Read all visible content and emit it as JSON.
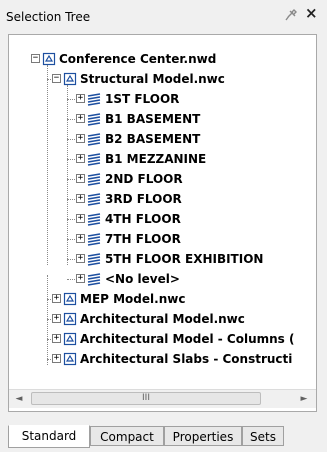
{
  "panel": {
    "title": "Selection Tree"
  },
  "tree": {
    "root": "Conference Center.nwd",
    "structural": "Structural Model.nwc",
    "levels": [
      "1ST FLOOR",
      "B1 BASEMENT",
      "B2 BASEMENT",
      "B1 MEZZANINE",
      "2ND FLOOR",
      "3RD FLOOR",
      "4TH FLOOR",
      "7TH FLOOR",
      "5TH FLOOR EXHIBITION",
      "<No level>"
    ],
    "models": [
      "MEP Model.nwc",
      "Architectural Model.nwc",
      "Architectural Model - Columns (",
      "Architectural Slabs - Constructi"
    ]
  },
  "scrollbar": {
    "left_arrow": "◄",
    "right_arrow": "►",
    "thumb_grip": "III"
  },
  "tabs": [
    "Standard",
    "Compact",
    "Properties",
    "Sets"
  ]
}
